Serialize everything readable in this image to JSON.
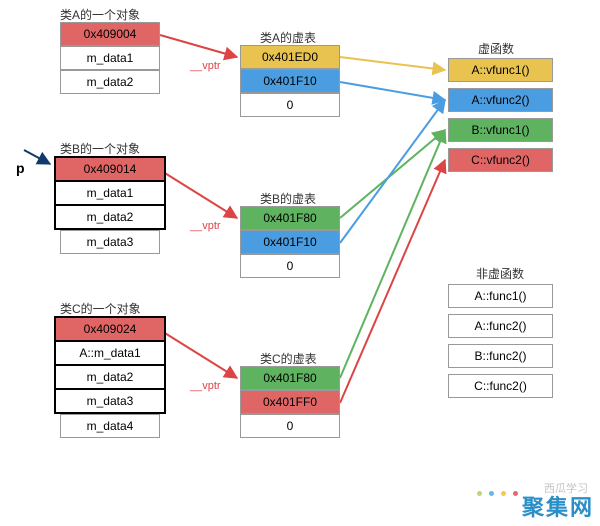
{
  "obj_a": {
    "title": "类A的一个对象",
    "vptr": "0x409004",
    "rows": [
      "m_data1",
      "m_data2"
    ]
  },
  "obj_b": {
    "title": "类B的一个对象",
    "vptr": "0x409014",
    "rows": [
      "m_data1",
      "m_data2",
      "m_data3"
    ]
  },
  "obj_c": {
    "title": "类C的一个对象",
    "vptr": "0x409024",
    "rows": [
      "A::m_data1",
      "m_data2",
      "m_data3",
      "m_data4"
    ]
  },
  "vt_a": {
    "title": "类A的虚表",
    "rows": [
      {
        "t": "0x401ED0",
        "c": "yellow"
      },
      {
        "t": "0x401F10",
        "c": "blue"
      },
      {
        "t": "0",
        "c": ""
      }
    ]
  },
  "vt_b": {
    "title": "类B的虚表",
    "rows": [
      {
        "t": "0x401F80",
        "c": "green"
      },
      {
        "t": "0x401F10",
        "c": "blue"
      },
      {
        "t": "0",
        "c": ""
      }
    ]
  },
  "vt_c": {
    "title": "类C的虚表",
    "rows": [
      {
        "t": "0x401F80",
        "c": "green"
      },
      {
        "t": "0x401FF0",
        "c": "red"
      },
      {
        "t": "0",
        "c": ""
      }
    ]
  },
  "vfunc": {
    "title": "虚函数",
    "rows": [
      {
        "t": "A::vfunc1()",
        "c": "yellow"
      },
      {
        "t": "A::vfunc2()",
        "c": "blue"
      },
      {
        "t": "B::vfunc1()",
        "c": "green"
      },
      {
        "t": "C::vfunc2()",
        "c": "red"
      }
    ]
  },
  "nvfunc": {
    "title": "非虚函数",
    "rows": [
      "A::func1()",
      "A::func2()",
      "B::func2()",
      "C::func2()"
    ]
  },
  "labels": {
    "vptr": "__vptr",
    "p": "p"
  },
  "watermark": {
    "brand": "聚集网",
    "small": "西瓜学习"
  }
}
